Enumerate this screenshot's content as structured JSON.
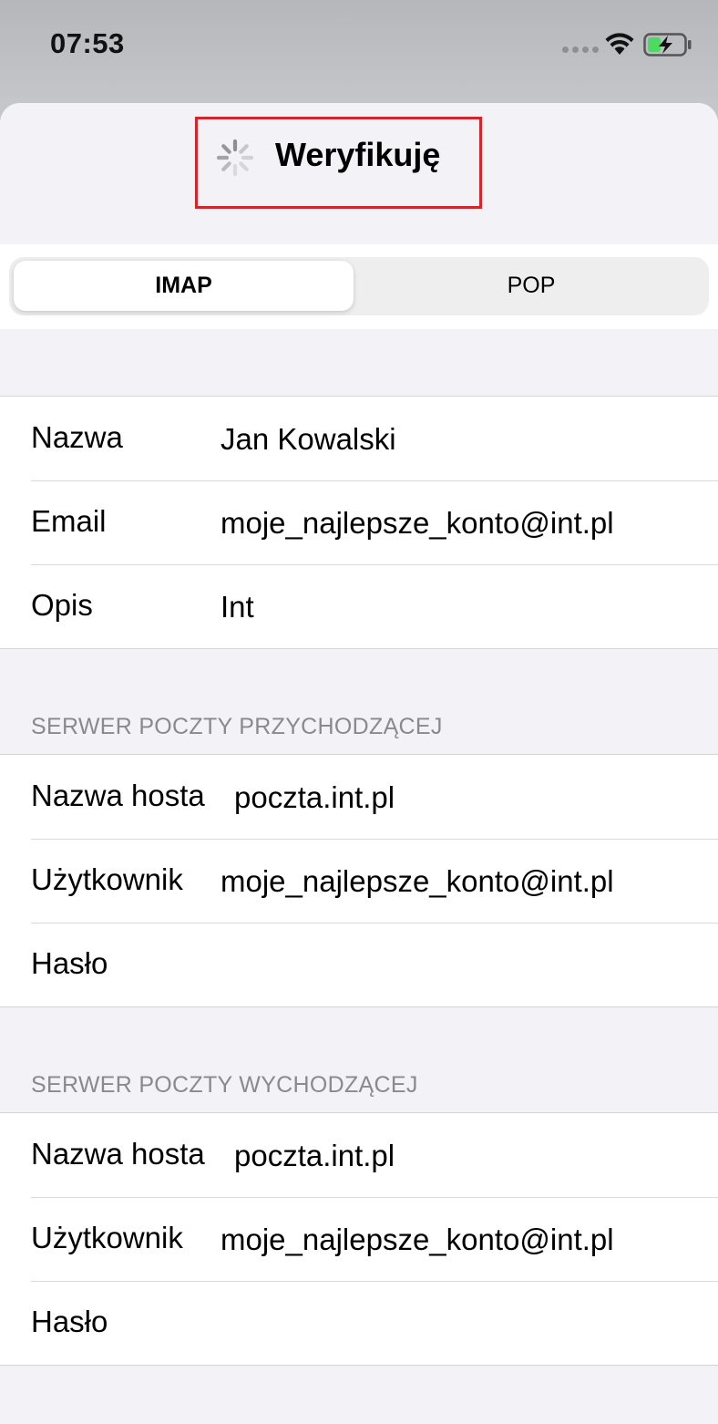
{
  "status_bar": {
    "time": "07:53",
    "icons": [
      "signal-dots-icon",
      "wifi-icon",
      "battery-charging-icon"
    ],
    "battery_color": "#4cd964"
  },
  "nav": {
    "title": "Weryfikuję",
    "spinner_icon": "activity-spinner-icon",
    "highlight_color": "#d0262e"
  },
  "segmented": {
    "imap_label": "IMAP",
    "pop_label": "POP",
    "selected": "IMAP"
  },
  "account": {
    "name_label": "Nazwa",
    "name_value": "Jan Kowalski",
    "email_label": "Email",
    "email_value": "moje_najlepsze_konto@int.pl",
    "description_label": "Opis",
    "description_value": "Int"
  },
  "incoming": {
    "header": "SERWER POCZTY PRZYCHODZĄCEJ",
    "host_label": "Nazwa hosta",
    "host_value": "poczta.int.pl",
    "user_label": "Użytkownik",
    "user_value": "moje_najlepsze_konto@int.pl",
    "password_label": "Hasło",
    "password_value": ""
  },
  "outgoing": {
    "header": "SERWER POCZTY WYCHODZĄCEJ",
    "host_label": "Nazwa hosta",
    "host_value": "poczta.int.pl",
    "user_label": "Użytkownik",
    "user_value": "moje_najlepsze_konto@int.pl",
    "password_label": "Hasło",
    "password_value": ""
  }
}
